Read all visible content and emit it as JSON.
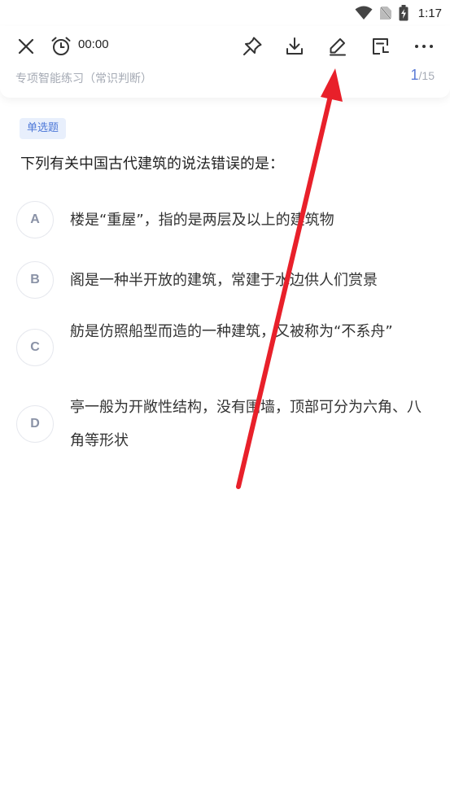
{
  "status_bar": {
    "time": "1:17"
  },
  "toolbar": {
    "timer": "00:00"
  },
  "exercise": {
    "title": "专项智能练习（常识判断）",
    "current": "1",
    "total": "/15"
  },
  "question": {
    "type_tag": "单选题",
    "stem": "下列有关中国古代建筑的说法错误的是：",
    "options": [
      {
        "letter": "A",
        "text": "楼是“重屋”，指的是两层及以上的建筑物"
      },
      {
        "letter": "B",
        "text": "阁是一种半开放的建筑，常建于水边供人们赏景"
      },
      {
        "letter": "C",
        "text": "舫是仿照船型而造的一种建筑，又被称为“不系舟”"
      },
      {
        "letter": "D",
        "text": "亭一般为开敞性结构，没有围墙，顶部可分为六角、八角等形状"
      }
    ]
  },
  "colors": {
    "accent": "#5b7bd6",
    "tag_bg": "#e8effc",
    "annotation": "#e8202a"
  }
}
